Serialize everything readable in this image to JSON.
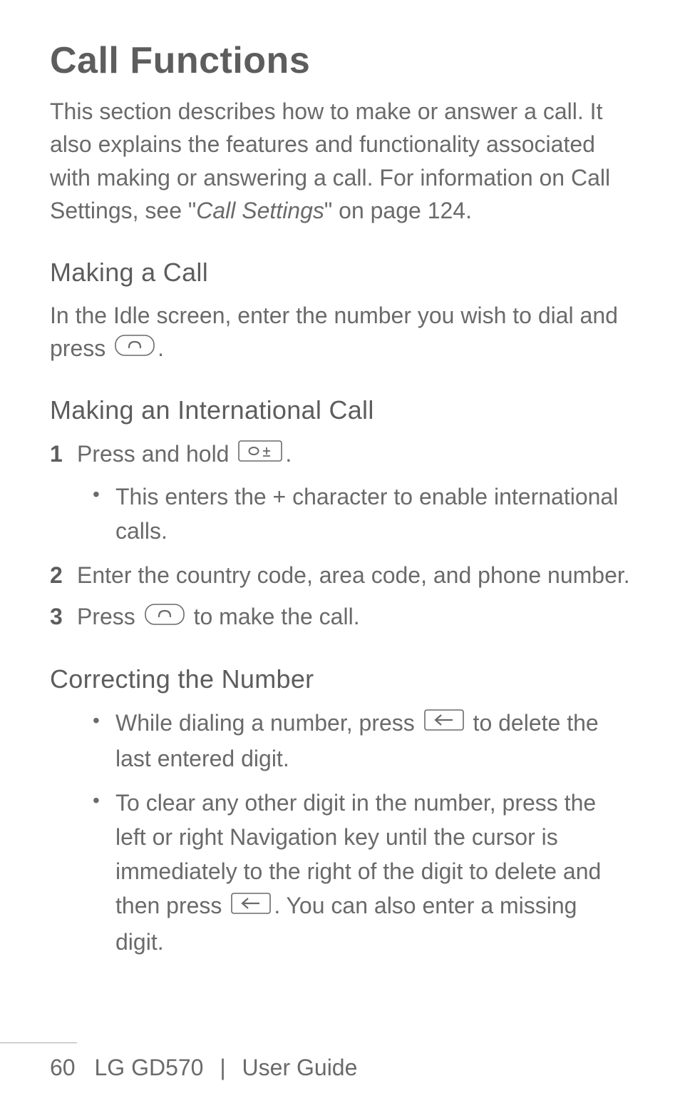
{
  "title": "Call Functions",
  "intro": {
    "part1": "This section describes how to make or answer a call. It also explains the features and functionality associated with making or answering a call. For information on Call Settings, see \"",
    "italic": "Call Settings",
    "part2": "\" on page 124."
  },
  "sections": {
    "making_call": {
      "heading": "Making a Call",
      "body_pre": "In the Idle screen, enter the number you wish to dial and press ",
      "body_post": "."
    },
    "international": {
      "heading": "Making an International Call",
      "steps": [
        {
          "num": "1",
          "pre": "Press and hold ",
          "icon": "zero-plus",
          "post": "."
        },
        {
          "num": "2",
          "text": "Enter the country code, area code, and phone number."
        },
        {
          "num": "3",
          "pre": "Press ",
          "icon": "send",
          "post": " to make the call."
        }
      ],
      "bullet": "This enters the + character to enable international calls."
    },
    "correcting": {
      "heading": "Correcting the Number",
      "bullets": [
        {
          "pre": "While dialing a number, press ",
          "icon": "back",
          "post": " to delete the last entered digit."
        },
        {
          "pre": "To clear any other digit in the number, press the left or right Navigation key until the cursor is immediately to the right of the digit to delete and then press ",
          "icon": "back",
          "post": ". You can also enter a missing digit."
        }
      ]
    }
  },
  "footer": {
    "page": "60",
    "model": "LG GD570",
    "divider": "|",
    "guide": "User Guide"
  }
}
